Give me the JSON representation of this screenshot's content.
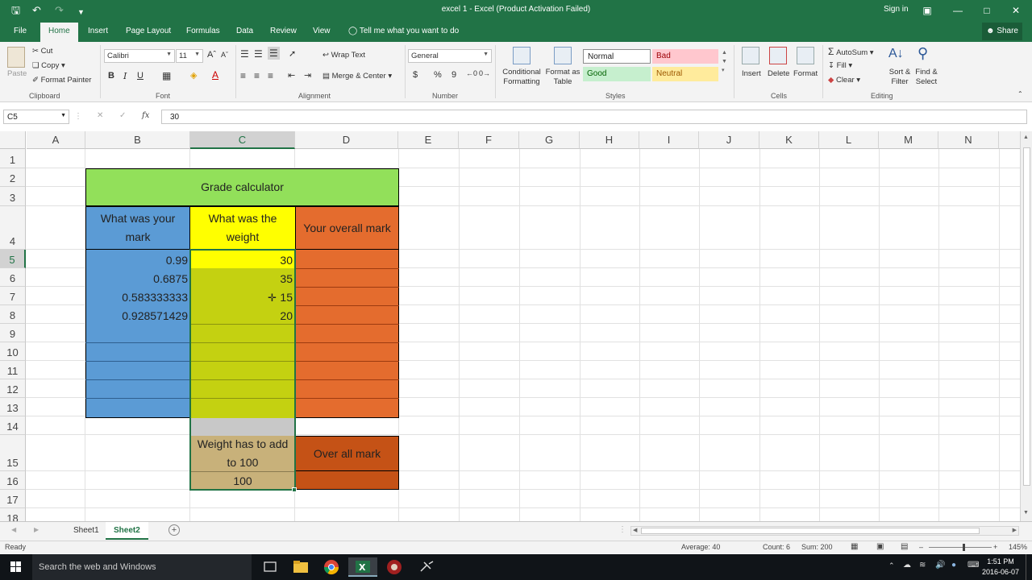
{
  "window": {
    "title": "excel 1 - Excel (Product Activation Failed)",
    "signin": "Sign in"
  },
  "tabs": [
    {
      "label": "File"
    },
    {
      "label": "Home"
    },
    {
      "label": "Insert"
    },
    {
      "label": "Page Layout"
    },
    {
      "label": "Formulas"
    },
    {
      "label": "Data"
    },
    {
      "label": "Review"
    },
    {
      "label": "View"
    }
  ],
  "tellme": "Tell me what you want to do",
  "share": "Share",
  "ribbon": {
    "clipboard": {
      "paste": "Paste",
      "cut": "Cut",
      "copy": "Copy",
      "format_painter": "Format Painter",
      "label": "Clipboard"
    },
    "font": {
      "name": "Calibri",
      "size": "11",
      "label": "Font",
      "bold": "B",
      "italic": "I",
      "underline": "U"
    },
    "alignment": {
      "wrap": "Wrap Text",
      "merge": "Merge & Center",
      "label": "Alignment"
    },
    "number": {
      "format": "General",
      "currency": "$",
      "percent": "%",
      "comma": "9",
      "label": "Number"
    },
    "styles": {
      "conditional": "Conditional Formatting",
      "format_table": "Format as Table",
      "normal": "Normal",
      "bad": "Bad",
      "good": "Good",
      "neutral": "Neutral",
      "label": "Styles"
    },
    "cells": {
      "insert": "Insert",
      "delete": "Delete",
      "format": "Format",
      "label": "Cells"
    },
    "editing": {
      "autosum": "AutoSum",
      "fill": "Fill",
      "clear": "Clear",
      "sort": "Sort & Filter",
      "find": "Find & Select",
      "label": "Editing"
    }
  },
  "formula_bar": {
    "name_box": "C5",
    "fx": "fx",
    "value": "30"
  },
  "columns": [
    "A",
    "B",
    "C",
    "D",
    "E",
    "F",
    "G",
    "H",
    "I",
    "J",
    "K",
    "L",
    "M",
    "N"
  ],
  "rows": [
    "1",
    "2",
    "3",
    "4",
    "5",
    "6",
    "7",
    "8",
    "9",
    "10",
    "11",
    "12",
    "13",
    "14",
    "15",
    "16",
    "17",
    "18"
  ],
  "sheet": {
    "title": "Grade calculator",
    "header_mark": "What was your mark",
    "header_weight": "What was the weight",
    "header_overall": "Your overall mark",
    "marks": [
      "0.99",
      "0.6875",
      "0.583333333",
      "0.928571429"
    ],
    "weights": [
      "30",
      "35",
      "15",
      "20"
    ],
    "weight_note": "Weight has to add to 100",
    "weight_total": "100",
    "overall_label": "Over all mark"
  },
  "sheet_tabs": [
    "Sheet1",
    "Sheet2"
  ],
  "status": {
    "ready": "Ready",
    "average": "Average: 40",
    "count": "Count: 6",
    "sum": "Sum: 200",
    "zoom": "145%"
  },
  "taskbar": {
    "search": "Search the web and Windows",
    "time": "1:51 PM",
    "date": "2016-06-07"
  },
  "colors": {
    "excel_green": "#217346",
    "title_green": "#92e05a",
    "mark_blue": "#5b9bd5",
    "weight_yellow": "#ffff00",
    "weight_olive": "#c4d111",
    "overall_orange": "#e46c2e",
    "tan": "#c8b17a",
    "dark_orange": "#c55216"
  }
}
